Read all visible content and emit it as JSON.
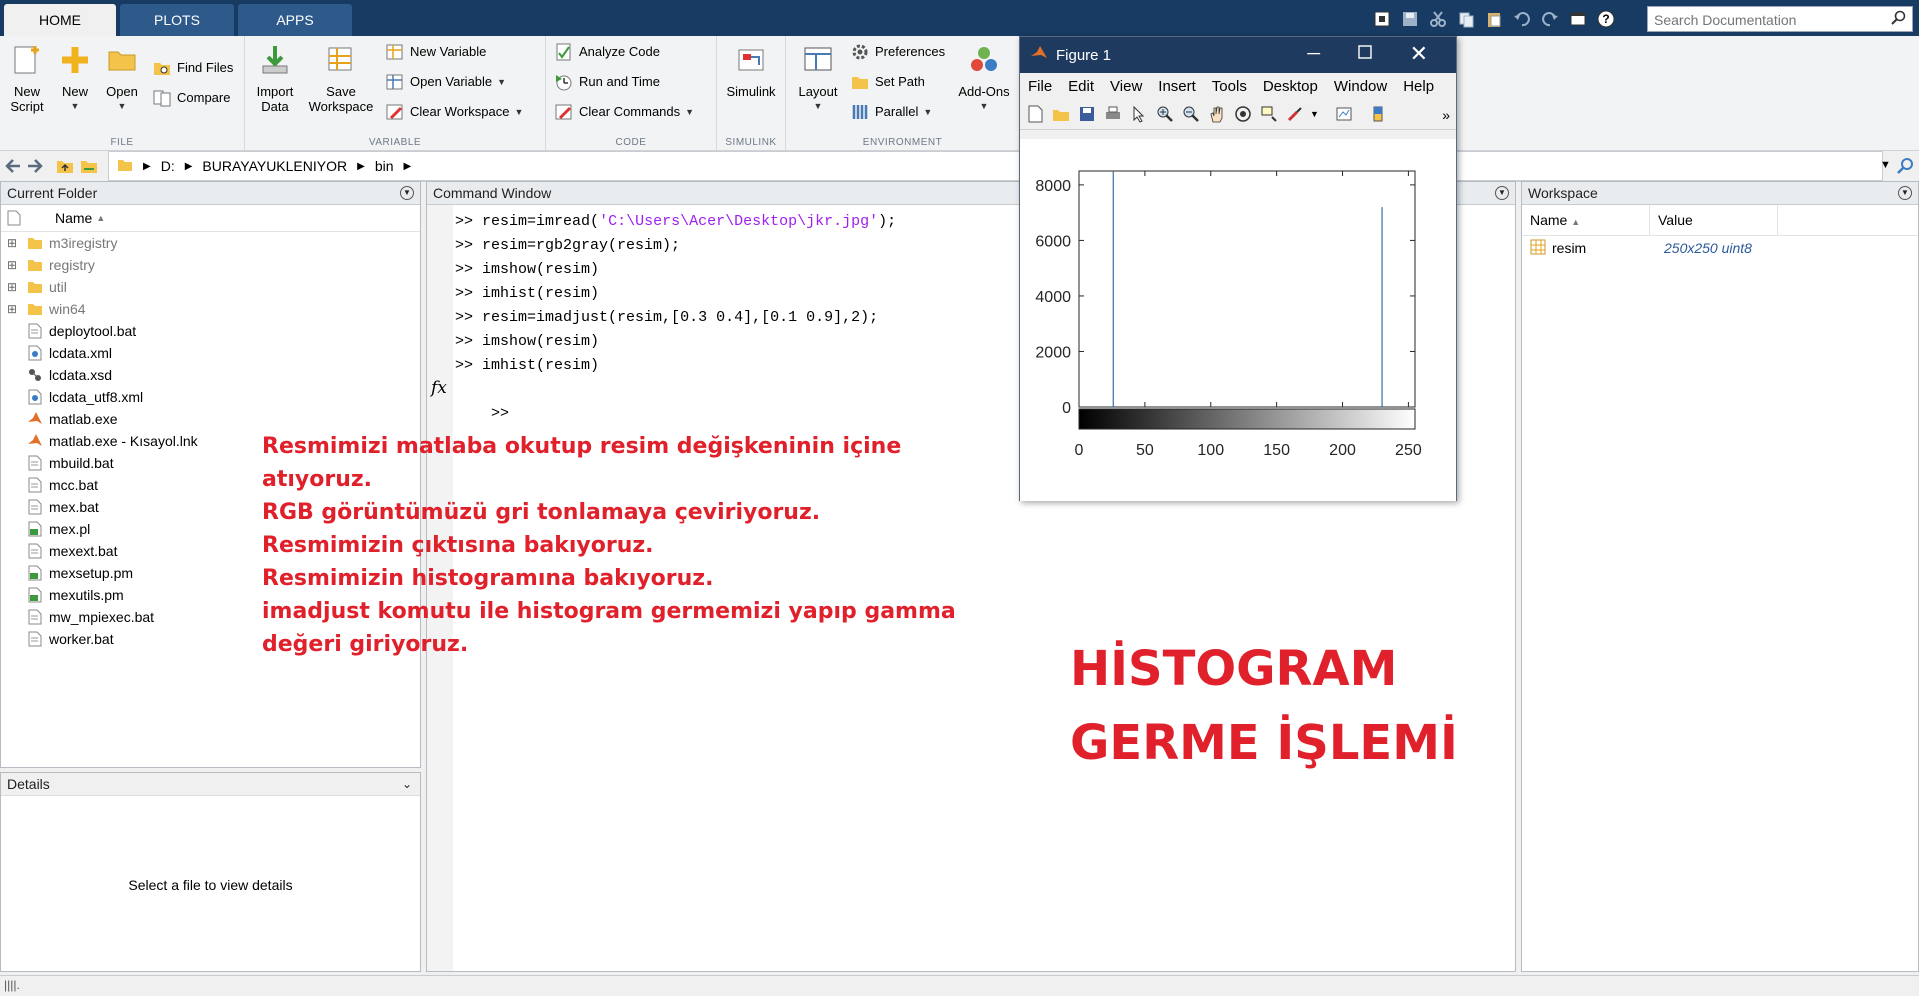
{
  "tabs": [
    {
      "label": "HOME",
      "active": true
    },
    {
      "label": "PLOTS",
      "active": false
    },
    {
      "label": "APPS",
      "active": false
    }
  ],
  "search": {
    "placeholder": "Search Documentation"
  },
  "ribbon": {
    "file": {
      "label": "FILE",
      "new_script": "New\nScript",
      "new": "New",
      "open": "Open",
      "find_files": "Find Files",
      "compare": "Compare"
    },
    "variable": {
      "label": "VARIABLE",
      "import_data": "Import\nData",
      "save_workspace": "Save\nWorkspace",
      "new_variable": "New Variable",
      "open_variable": "Open Variable",
      "clear_workspace": "Clear Workspace"
    },
    "code": {
      "label": "CODE",
      "analyze_code": "Analyze Code",
      "run_and_time": "Run and Time",
      "clear_commands": "Clear Commands"
    },
    "simulink": {
      "label": "SIMULINK",
      "simulink": "Simulink"
    },
    "environment": {
      "label": "ENVIRONMENT",
      "layout": "Layout",
      "preferences": "Preferences",
      "set_path": "Set Path",
      "parallel": "Parallel",
      "add_ons": "Add-Ons"
    }
  },
  "address": {
    "parts": [
      "D:",
      "BURAYAYUKLENIYOR",
      "bin"
    ]
  },
  "current_folder": {
    "title": "Current Folder",
    "column": "Name",
    "items": [
      {
        "name": "m3iregistry",
        "type": "folder"
      },
      {
        "name": "registry",
        "type": "folder"
      },
      {
        "name": "util",
        "type": "folder"
      },
      {
        "name": "win64",
        "type": "folder"
      },
      {
        "name": "deploytool.bat",
        "type": "bat"
      },
      {
        "name": "lcdata.xml",
        "type": "xml"
      },
      {
        "name": "lcdata.xsd",
        "type": "xsd"
      },
      {
        "name": "lcdata_utf8.xml",
        "type": "xml"
      },
      {
        "name": "matlab.exe",
        "type": "exe"
      },
      {
        "name": "matlab.exe - Kısayol.lnk",
        "type": "exe"
      },
      {
        "name": "mbuild.bat",
        "type": "bat"
      },
      {
        "name": "mcc.bat",
        "type": "bat"
      },
      {
        "name": "mex.bat",
        "type": "bat"
      },
      {
        "name": "mex.pl",
        "type": "pl"
      },
      {
        "name": "mexext.bat",
        "type": "bat"
      },
      {
        "name": "mexsetup.pm",
        "type": "pl"
      },
      {
        "name": "mexutils.pm",
        "type": "pl"
      },
      {
        "name": "mw_mpiexec.bat",
        "type": "bat"
      },
      {
        "name": "worker.bat",
        "type": "bat"
      }
    ]
  },
  "details": {
    "title": "Details",
    "message": "Select a file to view details"
  },
  "command_window": {
    "title": "Command Window",
    "prompt": ">>",
    "lines": [
      {
        "pre": "resim=imread(",
        "str": "'C:\\Users\\Acer\\Desktop\\jkr.jpg'",
        "post": ");"
      },
      {
        "pre": "resim=rgb2gray(resim);",
        "str": "",
        "post": ""
      },
      {
        "pre": "imshow(resim)",
        "str": "",
        "post": ""
      },
      {
        "pre": "imhist(resim)",
        "str": "",
        "post": ""
      },
      {
        "pre": "resim=imadjust(resim,[0.3 0.4],[0.1 0.9],2);",
        "str": "",
        "post": ""
      },
      {
        "pre": "imshow(resim)",
        "str": "",
        "post": ""
      },
      {
        "pre": "imhist(resim)",
        "str": "",
        "post": ""
      }
    ],
    "fx": "fx"
  },
  "workspace": {
    "title": "Workspace",
    "col_name": "Name",
    "col_value": "Value",
    "vars": [
      {
        "name": "resim",
        "value": "250x250 uint8"
      }
    ]
  },
  "figure": {
    "title": "Figure 1",
    "menu": [
      "File",
      "Edit",
      "View",
      "Insert",
      "Tools",
      "Desktop",
      "Window",
      "Help"
    ]
  },
  "chart_data": {
    "type": "bar",
    "x_ticks": [
      0,
      50,
      100,
      150,
      200,
      250
    ],
    "y_ticks": [
      0,
      2000,
      4000,
      6000,
      8000
    ],
    "xlim": [
      0,
      255
    ],
    "ylim": [
      0,
      8500
    ],
    "bars": [
      {
        "x": 26,
        "value": 8500
      },
      {
        "x": 230,
        "value": 7200
      }
    ],
    "colorbar": "grayscale"
  },
  "annotations": {
    "explanation": [
      "Resmimizi matlaba okutup resim değişkeninin içine",
      "atıyoruz.",
      "RGB görüntümüzü gri tonlamaya çeviriyoruz.",
      "Resmimizin çıktısına bakıyoruz.",
      "Resmimizin histogramına bakıyoruz.",
      "imadjust komutu ile histogram germemizi yapıp gamma",
      "değeri giriyoruz."
    ],
    "heading_line1": "HİSTOGRAM",
    "heading_line2": "GERME İŞLEMİ"
  },
  "colors": {
    "accent": "#173b63",
    "annotation": "#e0202a",
    "string": "#a020f0",
    "hist_bar": "#3a6ea5"
  }
}
